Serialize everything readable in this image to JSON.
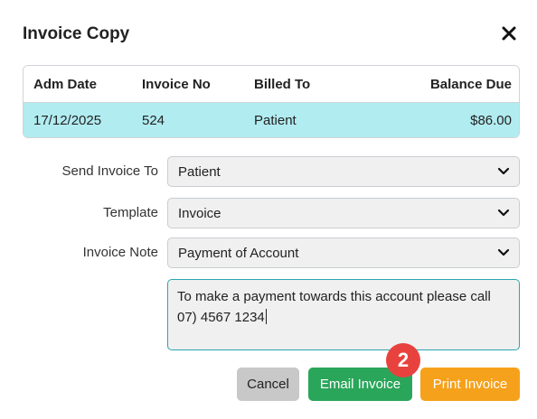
{
  "dialog": {
    "title": "Invoice Copy",
    "close_icon": "close-icon"
  },
  "invoice_table": {
    "headers": [
      "Adm Date",
      "Invoice No",
      "Billed To",
      "Balance Due"
    ],
    "rows": [
      [
        "17/12/2025",
        "524",
        "Patient",
        "$86.00"
      ]
    ],
    "selected_row_color": "#b1ecf1"
  },
  "form": {
    "send_invoice_to": {
      "label": "Send Invoice To",
      "value": "Patient"
    },
    "template": {
      "label": "Template",
      "value": "Invoice"
    },
    "invoice_note": {
      "label": "Invoice Note",
      "value": "Payment of Account"
    },
    "note_text": "To make a payment towards this account please call 07) 4567 1234"
  },
  "buttons": {
    "cancel": "Cancel",
    "email": "Email Invoice",
    "print": "Print Invoice"
  },
  "annotation": {
    "badge": "2"
  },
  "colors": {
    "accent_teal": "#2aa7b2",
    "email_green": "#2aa65a",
    "print_orange": "#f6a11b",
    "badge_red": "#e8423e"
  }
}
